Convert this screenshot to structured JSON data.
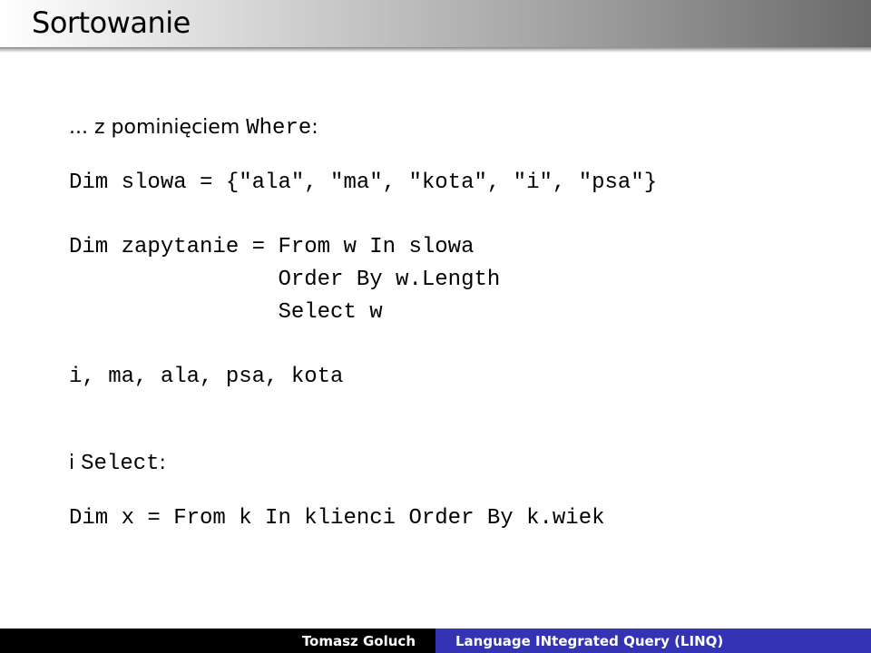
{
  "slide": {
    "title": "Sortowanie",
    "intro_prefix": "... z pominięciem ",
    "intro_keyword": "Where",
    "intro_suffix": ":",
    "code1": "Dim slowa = {\"ala\", \"ma\", \"kota\", \"i\", \"psa\"}",
    "code2_line1": "Dim zapytanie = From w In slowa",
    "code2_line2": "                Order By w.Length",
    "code2_line3": "                Select w",
    "result": "i, ma, ala, psa, kota",
    "section2_prefix": "i ",
    "section2_keyword": "Select",
    "section2_suffix": ":",
    "code3": "Dim x = From k In klienci Order By k.wiek"
  },
  "footer": {
    "author": "Tomasz Goluch",
    "talk_title": "Language INtegrated Query (LINQ)",
    "colors": {
      "left": "#000000",
      "right": "#3333b3"
    }
  }
}
